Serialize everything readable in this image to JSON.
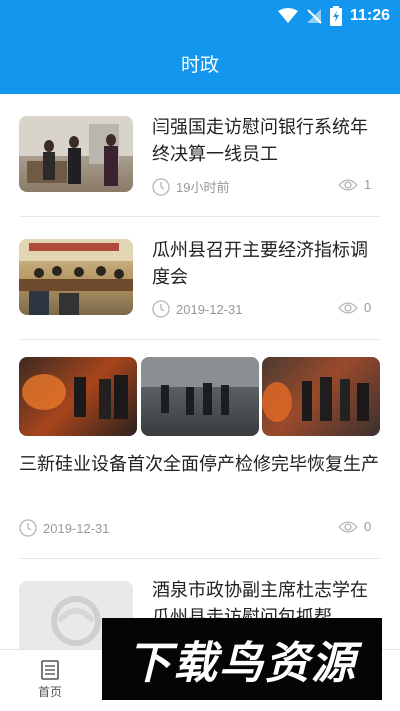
{
  "status_bar": {
    "time": "11:26",
    "icons": [
      "wifi-icon",
      "no-sim-icon",
      "battery-charging-icon"
    ]
  },
  "header": {
    "title": "时政"
  },
  "colors": {
    "brand": "#1296ee",
    "meta_text": "#999999",
    "title_text": "#222222"
  },
  "feed": {
    "items": [
      {
        "title": "闫强国走访慰问银行系统年终决算一线员工",
        "time": "19小时前",
        "views": "1"
      },
      {
        "title": "瓜州县召开主要经济指标调度会",
        "time": "2019-12-31",
        "views": "0"
      },
      {
        "title": "三新硅业设备首次全面停产检修完毕恢复生产",
        "time": "2019-12-31",
        "views": "0"
      },
      {
        "title": "酒泉市政协副主席杜志学在瓜州县走访慰问包抓帮"
      }
    ]
  },
  "bottom_nav": {
    "home_label": "首页"
  },
  "watermark": {
    "text": "下载鸟资源"
  }
}
